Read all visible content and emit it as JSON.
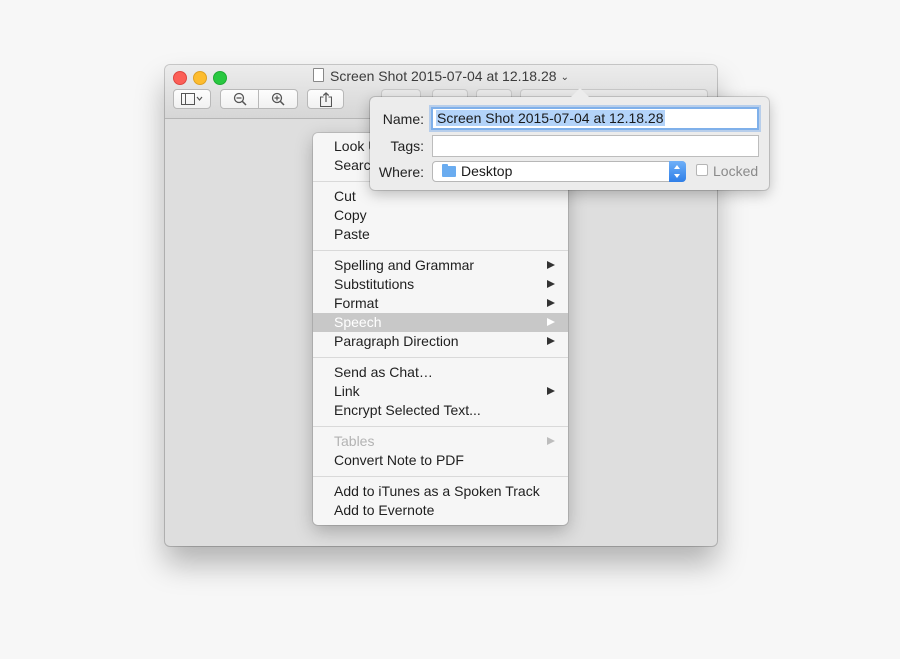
{
  "window": {
    "title": "Screen Shot 2015-07-04 at 12.18.28",
    "toolbar": {
      "sidebar_icon": "sidebar-icon",
      "zoom_out_icon": "zoom-out-icon",
      "zoom_in_icon": "zoom-in-icon",
      "share_icon": "share-icon"
    }
  },
  "context_menu": {
    "groups": [
      {
        "items": [
          {
            "label": "Look Up"
          },
          {
            "label": "Search"
          }
        ]
      },
      {
        "items": [
          {
            "label": "Cut"
          },
          {
            "label": "Copy"
          },
          {
            "label": "Paste"
          }
        ]
      },
      {
        "items": [
          {
            "label": "Spelling and Grammar",
            "submenu": true
          },
          {
            "label": "Substitutions",
            "submenu": true
          },
          {
            "label": "Format",
            "submenu": true
          },
          {
            "label": "Speech",
            "submenu": true,
            "highlighted": true
          },
          {
            "label": "Paragraph Direction",
            "submenu": true
          }
        ]
      },
      {
        "items": [
          {
            "label": "Send as Chat…"
          },
          {
            "label": "Link",
            "submenu": true
          },
          {
            "label": "Encrypt Selected Text..."
          }
        ]
      },
      {
        "items": [
          {
            "label": "Tables",
            "submenu": true,
            "disabled": true
          },
          {
            "label": "Convert Note to PDF"
          }
        ]
      },
      {
        "items": [
          {
            "label": "Add to iTunes as a Spoken Track"
          },
          {
            "label": "Add to Evernote"
          }
        ]
      }
    ]
  },
  "rename_popover": {
    "name_label": "Name:",
    "name_value": "Screen Shot 2015-07-04 at 12.18.28",
    "tags_label": "Tags:",
    "tags_value": "",
    "where_label": "Where:",
    "where_value": "Desktop",
    "where_icon": "folder-icon",
    "locked_label": "Locked",
    "locked_checked": false
  },
  "colors": {
    "menu_highlight": "#c8c8c8",
    "focus_ring": "#7fb0ea",
    "selection": "#b3d3f9",
    "select_accent": "#2f7fe8"
  }
}
